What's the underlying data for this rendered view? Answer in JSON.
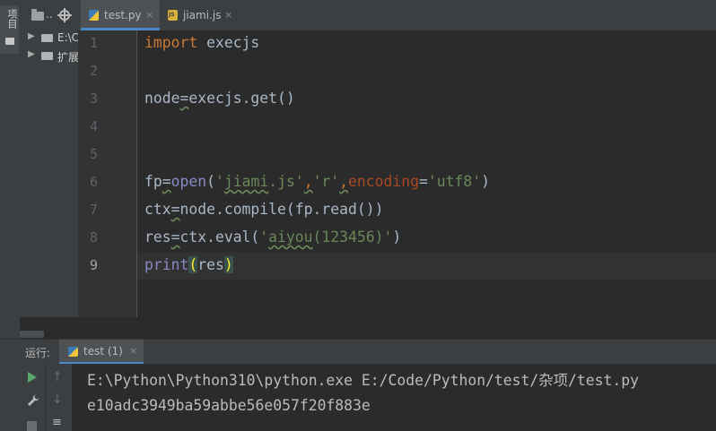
{
  "project_panel": {
    "label": "项目",
    "header_dots": "..",
    "tree": [
      {
        "label": "E:\\C"
      },
      {
        "label": "扩展"
      }
    ]
  },
  "tabs": [
    {
      "name": "test.py",
      "close": "×",
      "active": true
    },
    {
      "name": "jiami.js",
      "close": "×",
      "active": false
    }
  ],
  "editor": {
    "line_numbers": [
      "1",
      "2",
      "3",
      "4",
      "5",
      "6",
      "7",
      "8",
      "9"
    ],
    "current_line": 9,
    "lines": [
      "import execjs",
      "",
      "node=execjs.get()",
      "",
      "",
      "fp=open('jiami.js','r',encoding='utf8')",
      "ctx=node.compile(fp.read())",
      "res=ctx.eval('aiyou(123456)')",
      "print(res)"
    ]
  },
  "run_panel": {
    "label": "运行:",
    "tab_name": "test (1)",
    "tab_close": "×",
    "output": [
      "E:\\Python\\Python310\\python.exe E:/Code/Python/test/杂项/test.py",
      "e10adc3949ba59abbe56e057f20f883e"
    ]
  },
  "colors": {
    "keyword": "#cc7832",
    "string": "#6a8759",
    "builtin": "#8888c6",
    "param": "#aa4926",
    "text": "#a9b7c6",
    "accent": "#4a88c7",
    "run_green": "#59a869"
  },
  "icons": [
    "folder-icon",
    "locate-icon",
    "python-file-icon",
    "js-file-icon",
    "run-icon",
    "wrench-icon",
    "stop-icon",
    "up-arrow-icon",
    "down-arrow-icon",
    "soft-wrap-icon"
  ]
}
